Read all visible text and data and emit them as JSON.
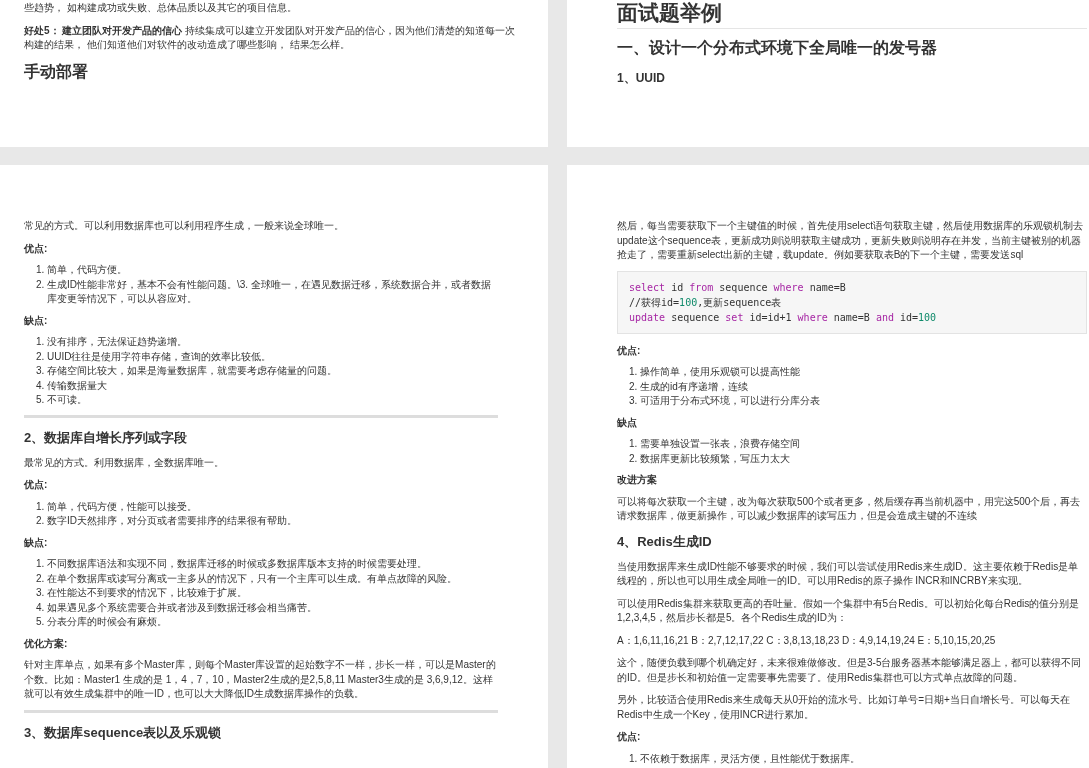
{
  "pages": [
    {
      "blocks": [
        {
          "kind": "para",
          "text": "些趋势， 如构建成功或失败、总体品质以及其它的项目信息。"
        },
        {
          "kind": "para",
          "text": "**好处5： 建立团队对开发产品的信心** 持续集成可以建立开发团队对开发产品的信心，因为他们清楚的知道每一次构建的结果， 他们知道他们对软件的改动造成了哪些影响， 结果怎么样。"
        },
        {
          "kind": "section",
          "text": "手动部署"
        }
      ]
    },
    {
      "blocks": [
        {
          "kind": "title",
          "text": "面试题举例"
        },
        {
          "kind": "section",
          "text": "一、设计一个分布式环境下全局唯一的发号器"
        },
        {
          "kind": "subsection",
          "text": "1、UUID"
        }
      ]
    },
    {
      "blocks": [
        {
          "kind": "para",
          "text": "常见的方式。可以利用数据库也可以利用程序生成，一般来说全球唯一。"
        },
        {
          "kind": "label",
          "text": "优点:"
        },
        {
          "kind": "list",
          "items": [
            {
              "number": "1.",
              "text": "简单，代码方便。"
            },
            {
              "number": "2.",
              "text": "生成ID性能非常好，基本不会有性能问题。\\3. 全球唯一，在遇见数据迁移，系统数据合并，或者数据库变更等情况下，可以从容应对。"
            }
          ]
        },
        {
          "kind": "label",
          "text": "缺点:"
        },
        {
          "kind": "list",
          "items": [
            {
              "number": "1.",
              "text": "没有排序，无法保证趋势递增。"
            },
            {
              "number": "2.",
              "text": "UUID往往是使用字符串存储，查询的效率比较低。"
            },
            {
              "number": "3.",
              "text": "存储空间比较大，如果是海量数据库，就需要考虑存储量的问题。"
            },
            {
              "number": "4.",
              "text": "传输数据量大"
            },
            {
              "number": "5.",
              "text": "不可读。"
            }
          ]
        },
        {
          "kind": "rule"
        },
        {
          "kind": "heading",
          "text": "2、数据库自增长序列或字段"
        },
        {
          "kind": "para",
          "text": "最常见的方式。利用数据库，全数据库唯一。"
        },
        {
          "kind": "label",
          "text": "优点:"
        },
        {
          "kind": "list",
          "items": [
            {
              "number": "1.",
              "text": "简单，代码方便，性能可以接受。"
            },
            {
              "number": "2.",
              "text": "数字ID天然排序，对分页或者需要排序的结果很有帮助。"
            }
          ]
        },
        {
          "kind": "label",
          "text": "缺点:"
        },
        {
          "kind": "list",
          "items": [
            {
              "number": "1.",
              "text": "不同数据库语法和实现不同，数据库迁移的时候或多数据库版本支持的时候需要处理。"
            },
            {
              "number": "2.",
              "text": "在单个数据库或读写分离或一主多从的情况下，只有一个主库可以生成。有单点故障的风险。"
            },
            {
              "number": "3.",
              "text": "在性能达不到要求的情况下，比较难于扩展。"
            },
            {
              "number": "4.",
              "text": "如果遇见多个系统需要合并或者涉及到数据迁移会相当痛苦。"
            },
            {
              "number": "5.",
              "text": "分表分库的时候会有麻烦。"
            }
          ]
        },
        {
          "kind": "label",
          "text": "优化方案:"
        },
        {
          "kind": "para",
          "text": "针对主库单点，如果有多个Master库，则每个Master库设置的起始数字不一样，步长一样，可以是Master的个数。比如：Master1 生成的是 1，4，7，10，Master2生成的是2,5,8,11 Master3生成的是 3,6,9,12。这样就可以有效生成集群中的唯一ID，也可以大大降低ID生成数据库操作的负载。"
        },
        {
          "kind": "rule"
        },
        {
          "kind": "heading",
          "text": "3、数据库sequence表以及乐观锁"
        }
      ]
    },
    {
      "blocks": [
        {
          "kind": "para",
          "text": "然后，每当需要获取下一个主键值的时候，首先使用select语句获取主键，然后使用数据库的乐观锁机制去update这个sequence表，更新成功则说明获取主键成功，更新失败则说明存在并发，当前主键被别的机器抢走了，需要重新select出新的主键，载update。例如要获取表B的下一个主键，需要发送sql"
        },
        {
          "kind": "code",
          "lines": [
            [
              {
                "kind": "keyword",
                "text": "select"
              },
              {
                "kind": "plain",
                "text": " id "
              },
              {
                "kind": "keyword",
                "text": "from"
              },
              {
                "kind": "plain",
                "text": " sequence "
              },
              {
                "kind": "keyword",
                "text": "where"
              },
              {
                "kind": "plain",
                "text": " name=B"
              }
            ],
            [
              {
                "kind": "plain",
                "text": "//获得id="
              },
              {
                "kind": "number",
                "text": "100"
              },
              {
                "kind": "plain",
                "text": ",更新sequence表"
              }
            ],
            [
              {
                "kind": "keyword",
                "text": "update"
              },
              {
                "kind": "plain",
                "text": " sequence "
              },
              {
                "kind": "keyword",
                "text": "set"
              },
              {
                "kind": "plain",
                "text": " id=id+1 "
              },
              {
                "kind": "keyword",
                "text": "where"
              },
              {
                "kind": "plain",
                "text": " name=B "
              },
              {
                "kind": "keyword",
                "text": "and"
              },
              {
                "kind": "plain",
                "text": " id="
              },
              {
                "kind": "number",
                "text": "100"
              }
            ]
          ]
        },
        {
          "kind": "label",
          "text": "优点:"
        },
        {
          "kind": "list",
          "items": [
            {
              "number": "1.",
              "text": "操作简单，使用乐观锁可以提高性能"
            },
            {
              "number": "2.",
              "text": "生成的id有序递增，连续"
            },
            {
              "number": "3.",
              "text": "可适用于分布式环境，可以进行分库分表"
            }
          ]
        },
        {
          "kind": "label",
          "text": "缺点"
        },
        {
          "kind": "list",
          "items": [
            {
              "number": "1.",
              "text": "需要单独设置一张表，浪费存储空间"
            },
            {
              "number": "2.",
              "text": "数据库更新比较频繁，写压力太大"
            }
          ]
        },
        {
          "kind": "label",
          "text": "改进方案"
        },
        {
          "kind": "para",
          "text": "可以将每次获取一个主键，改为每次获取500个或者更多，然后缓存再当前机器中，用完这500个后，再去请求数据库，做更新操作，可以减少数据库的读写压力，但是会造成主键的不连续"
        },
        {
          "kind": "heading",
          "text": "4、Redis生成ID"
        },
        {
          "kind": "para",
          "text": "当使用数据库来生成ID性能不够要求的时候，我们可以尝试使用Redis来生成ID。这主要依赖于Redis是单线程的，所以也可以用生成全局唯一的ID。可以用Redis的原子操作 INCR和INCRBY来实现。"
        },
        {
          "kind": "para",
          "text": "可以使用Redis集群来获取更高的吞吐量。假如一个集群中有5台Redis。可以初始化每台Redis的值分别是1,2,3,4,5，然后步长都是5。各个Redis生成的ID为："
        },
        {
          "kind": "para",
          "text": "A：1,6,11,16,21 B：2,7,12,17,22 C：3,8,13,18,23 D：4,9,14,19,24 E：5,10,15,20,25"
        },
        {
          "kind": "para",
          "text": "这个，随便负载到哪个机确定好，未来很难做修改。但是3-5台服务器基本能够满足器上，都可以获得不同的ID。但是步长和初始值一定需要事先需要了。使用Redis集群也可以方式单点故障的问题。"
        },
        {
          "kind": "para",
          "text": "另外，比较适合使用Redis来生成每天从0开始的流水号。比如订单号=日期+当日自增长号。可以每天在Redis中生成一个Key，使用INCR进行累加。"
        },
        {
          "kind": "label",
          "text": "优点:"
        },
        {
          "kind": "list",
          "items": [
            {
              "number": "1.",
              "text": "不依赖于数据库，灵活方便，且性能优于数据库。"
            }
          ]
        }
      ]
    }
  ]
}
